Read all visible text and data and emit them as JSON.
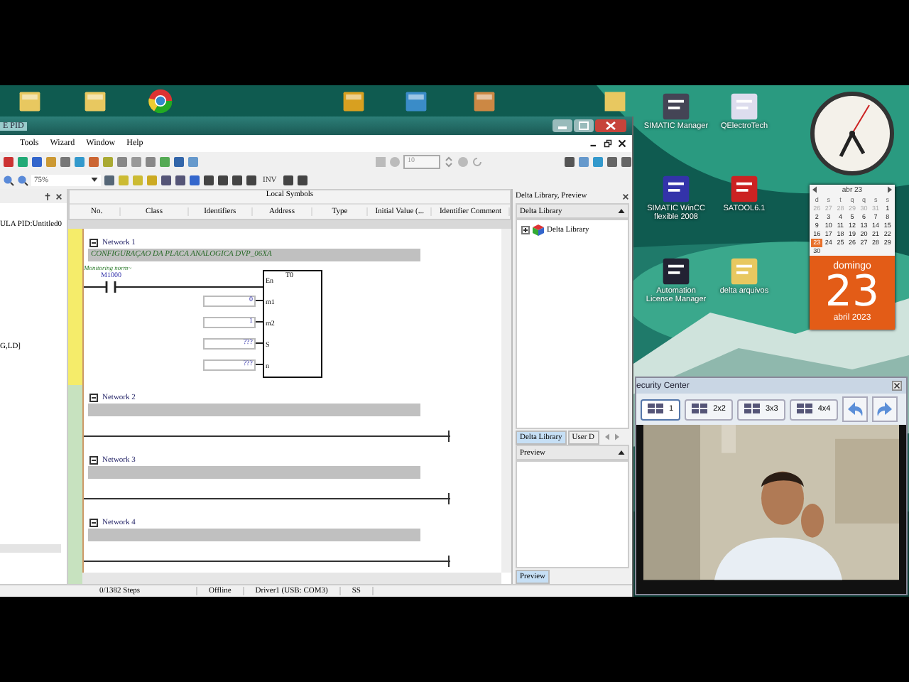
{
  "main_window": {
    "title": "E PID",
    "menu": [
      "Tools",
      "Wizard",
      "Window",
      "Help"
    ],
    "step_field": "10",
    "zoom": "75%",
    "inv_label": "INV",
    "project_pane": {
      "items": [
        "ULA PID:Untitled0",
        "G,LD]"
      ]
    },
    "symbols_panel": {
      "title": "Local Symbols",
      "columns": [
        "No.",
        "Class",
        "Identifiers",
        "Address",
        "Type",
        "Initial Value (...",
        "Identifier Comment"
      ]
    },
    "networks": [
      {
        "title": "Network 1",
        "kind": "timer",
        "comment": "CONFIGURAÇAO DA PLACA ANALOGICA DVP_06XA",
        "monitor": "Monitoring norm~",
        "contact": "M1000",
        "block": "T0",
        "pins": [
          {
            "label": "En"
          },
          {
            "label": "m1",
            "value": "0"
          },
          {
            "label": "m2",
            "value": "1"
          },
          {
            "label": "S",
            "value": "???"
          },
          {
            "label": "n",
            "value": "???"
          }
        ]
      },
      {
        "title": "Network 2",
        "kind": "empty"
      },
      {
        "title": "Network 3",
        "kind": "empty"
      },
      {
        "title": "Network 4",
        "kind": "empty"
      }
    ],
    "library_panel": {
      "title": "Delta Library, Preview",
      "section": "Delta Library",
      "tree": [
        {
          "label": "Delta Library",
          "expanded": false
        }
      ],
      "tabs": [
        {
          "label": "Delta Library",
          "selected": true
        },
        {
          "label": "User D",
          "selected": false
        }
      ],
      "preview_title": "Preview",
      "preview_tab": "Preview"
    },
    "status_bar": [
      "0/1382 Steps",
      "Offline",
      "Driver1 (USB: COM3)",
      "SS"
    ]
  },
  "desktop_icons": [
    {
      "label": "SIMATIC Manager",
      "kind": "simatic"
    },
    {
      "label": "QElectroTech",
      "kind": "qet"
    },
    {
      "label": "SIMATIC WinCC flexible 2008",
      "kind": "wincc"
    },
    {
      "label": "SATOOL6.1",
      "kind": "satool"
    },
    {
      "label": "Automation License Manager",
      "kind": "license"
    },
    {
      "label": "delta arquivos",
      "kind": "folder"
    }
  ],
  "calendar": {
    "month": "abr 23",
    "weekdays": [
      "d",
      "s",
      "t",
      "q",
      "q",
      "s",
      "s"
    ],
    "days": [
      {
        "label": "26",
        "muted": true,
        "selected": false
      },
      {
        "label": "27",
        "muted": true,
        "selected": false
      },
      {
        "label": "28",
        "muted": true,
        "selected": false
      },
      {
        "label": "29",
        "muted": true,
        "selected": false
      },
      {
        "label": "30",
        "muted": true,
        "selected": false
      },
      {
        "label": "31",
        "muted": true,
        "selected": false
      },
      {
        "label": "1",
        "muted": false,
        "selected": false
      },
      {
        "label": "2",
        "muted": false,
        "selected": false
      },
      {
        "label": "3",
        "muted": false,
        "selected": false
      },
      {
        "label": "4",
        "muted": false,
        "selected": false
      },
      {
        "label": "5",
        "muted": false,
        "selected": false
      },
      {
        "label": "6",
        "muted": false,
        "selected": false
      },
      {
        "label": "7",
        "muted": false,
        "selected": false
      },
      {
        "label": "8",
        "muted": false,
        "selected": false
      },
      {
        "label": "9",
        "muted": false,
        "selected": false
      },
      {
        "label": "10",
        "muted": false,
        "selected": false
      },
      {
        "label": "11",
        "muted": false,
        "selected": false
      },
      {
        "label": "12",
        "muted": false,
        "selected": false
      },
      {
        "label": "13",
        "muted": false,
        "selected": false
      },
      {
        "label": "14",
        "muted": false,
        "selected": false
      },
      {
        "label": "15",
        "muted": false,
        "selected": false
      },
      {
        "label": "16",
        "muted": false,
        "selected": false
      },
      {
        "label": "17",
        "muted": false,
        "selected": false
      },
      {
        "label": "18",
        "muted": false,
        "selected": false
      },
      {
        "label": "19",
        "muted": false,
        "selected": false
      },
      {
        "label": "20",
        "muted": false,
        "selected": false
      },
      {
        "label": "21",
        "muted": false,
        "selected": false
      },
      {
        "label": "22",
        "muted": false,
        "selected": false
      },
      {
        "label": "23",
        "muted": false,
        "selected": true
      },
      {
        "label": "24",
        "muted": false,
        "selected": false
      },
      {
        "label": "25",
        "muted": false,
        "selected": false
      },
      {
        "label": "26",
        "muted": false,
        "selected": false
      },
      {
        "label": "27",
        "muted": false,
        "selected": false
      },
      {
        "label": "28",
        "muted": false,
        "selected": false
      },
      {
        "label": "29",
        "muted": false,
        "selected": false
      },
      {
        "label": "30",
        "muted": false,
        "selected": false
      }
    ],
    "weekday": "domingo",
    "day": "23",
    "month_year": "abril 2023"
  },
  "video_window": {
    "title": "ecurity Center",
    "layouts": [
      {
        "label": "1",
        "selected": true
      },
      {
        "label": "2x2",
        "selected": false
      },
      {
        "label": "3x3",
        "selected": false
      },
      {
        "label": "4x4",
        "selected": false
      }
    ]
  }
}
